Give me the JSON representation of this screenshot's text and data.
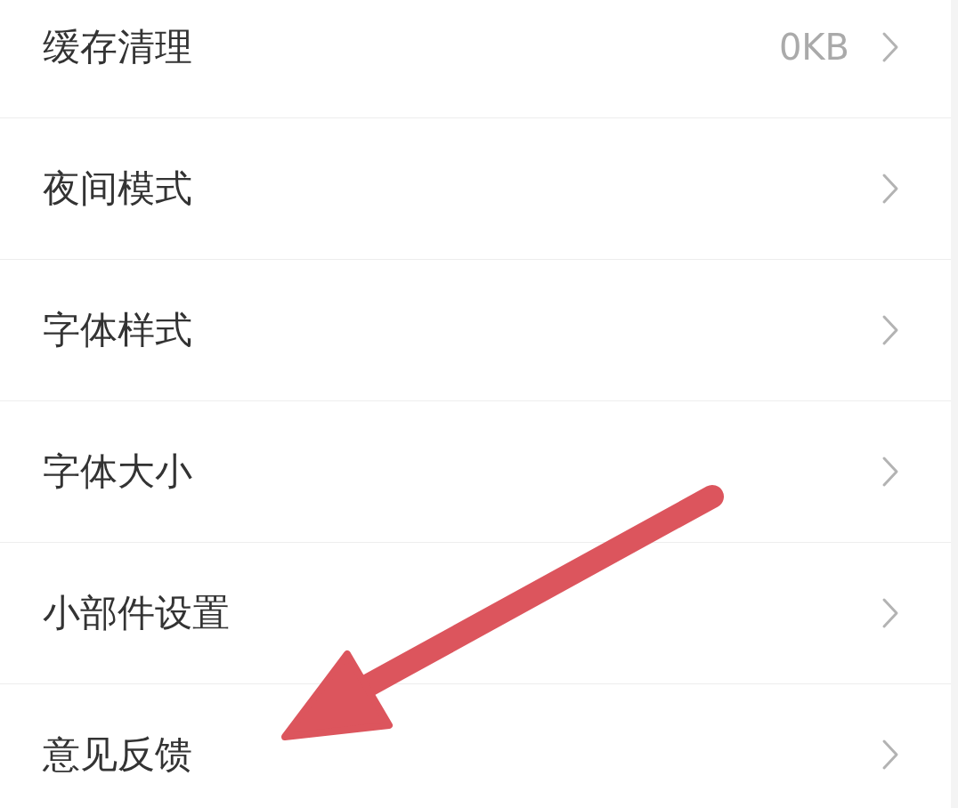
{
  "settings": [
    {
      "label": "缓存清理",
      "value": "0KB"
    },
    {
      "label": "夜间模式"
    },
    {
      "label": "字体样式"
    },
    {
      "label": "字体大小"
    },
    {
      "label": "小部件设置"
    },
    {
      "label": "意见反馈"
    }
  ],
  "annotations": [
    {
      "kind": "arrow"
    }
  ]
}
